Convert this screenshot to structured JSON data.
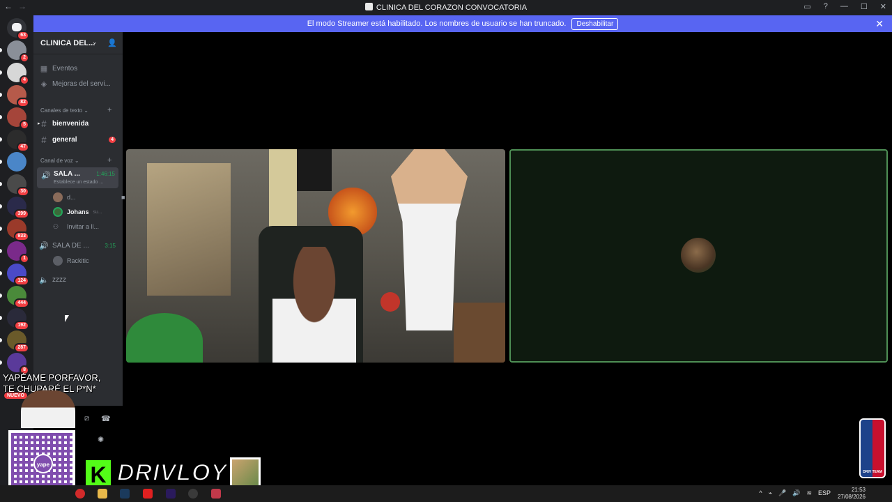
{
  "window": {
    "title": "CLINICA DEL CORAZON CONVOCATORIA",
    "back_glyph": "←",
    "forward_glyph": "→",
    "inbox_icon": "inbox-icon",
    "help_glyph": "?",
    "minimize_glyph": "—",
    "maximize_glyph": "☐",
    "close_glyph": "✕"
  },
  "banner": {
    "message": "El modo Streamer está habilitado. Los nombres de usuario se han truncado.",
    "button_label": "Deshabilitar",
    "close_glyph": "✕",
    "color": "#5865f2"
  },
  "rail": {
    "home_badge": "63",
    "servers": [
      {
        "badge": "2"
      },
      {
        "badge": "4"
      },
      {
        "badge": "82"
      },
      {
        "badge": "5"
      },
      {
        "badge": "47"
      },
      {
        "badge": ""
      },
      {
        "badge": "30"
      },
      {
        "badge": "399"
      },
      {
        "badge": "933"
      },
      {
        "badge": "1"
      },
      {
        "badge": "124"
      },
      {
        "badge": "444"
      },
      {
        "badge": "192"
      },
      {
        "badge": "287"
      },
      {
        "badge": "8"
      }
    ]
  },
  "sidebar": {
    "server_name": "CLINICA DEL...",
    "chevron_glyph": "⌄",
    "invite_glyph": "👤",
    "top_items": [
      {
        "label": "Eventos",
        "icon": "calendar-icon"
      },
      {
        "label": "Mejoras del servi...",
        "icon": "boost-icon"
      }
    ],
    "text_category": "Canales de texto",
    "text_channels": [
      {
        "name": "bienvenida",
        "count": ""
      },
      {
        "name": "general",
        "count": "4"
      }
    ],
    "voice_category": "Canal de voz",
    "active_voice": {
      "name": "SALA ...",
      "time": "1:46:15",
      "status": "Establece un estado ..."
    },
    "active_voice_users": [
      {
        "name": "d...",
        "extra": ""
      },
      {
        "name": "Johans",
        "extra": "su..."
      }
    ],
    "invite_label": "Invitar a ll...",
    "voice2": {
      "name": "SALA DE ...",
      "time": "3:15"
    },
    "voice2_users": [
      {
        "name": "Rackitic"
      }
    ],
    "voice3": {
      "name": "zzzz"
    },
    "plus_glyph": "+",
    "hash_glyph": "#",
    "speaker_glyph": "🔊"
  },
  "stage": {
    "active_border_color": "#4e8f55"
  },
  "overlay": {
    "text_line1": "YAPÉAME PORFAVOR,",
    "text_line2": "TE CHUPARÉ  EL P*N*",
    "new_badge": "NUEVO",
    "qr_logo": "yape",
    "kick_letter": "K",
    "streamer_name": "DRIVLOY",
    "nba_label": "DRIV TEAM"
  },
  "taskbar": {
    "language": "ESP",
    "time": "21:53",
    "date": "27/08/2026"
  }
}
